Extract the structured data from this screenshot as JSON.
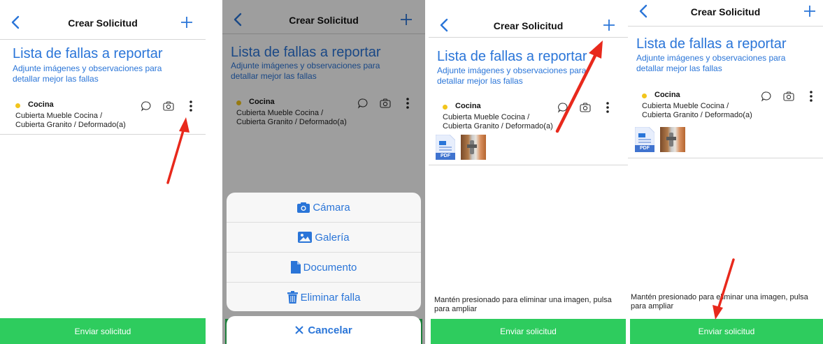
{
  "nav": {
    "title": "Crear Solicitud"
  },
  "list": {
    "title": "Lista de fallas a reportar",
    "subtitle": "Adjunte imágenes y observaciones para detallar mejor las fallas"
  },
  "fault": {
    "name": "Cocina",
    "line1": "Cubierta Mueble Cocina /",
    "line2": "Cubierta Granito / Deformado(a)",
    "dot_color": "#f2c51c"
  },
  "attachments": [
    {
      "type": "pdf",
      "badge": "PDF"
    },
    {
      "type": "photo"
    }
  ],
  "hint": "Mantén presionado para eliminar una imagen, pulsa para ampliar",
  "send_button": "Enviar solicitud",
  "sheet": {
    "items": [
      {
        "label": "Cámara",
        "icon": "camera-icon"
      },
      {
        "label": "Galería",
        "icon": "gallery-icon"
      },
      {
        "label": "Documento",
        "icon": "document-icon"
      },
      {
        "label": "Eliminar falla",
        "icon": "trash-icon"
      }
    ],
    "cancel": "Cancelar"
  },
  "colors": {
    "accent": "#2a75d8",
    "send": "#2ecc5e",
    "arrow": "#e8291c"
  }
}
